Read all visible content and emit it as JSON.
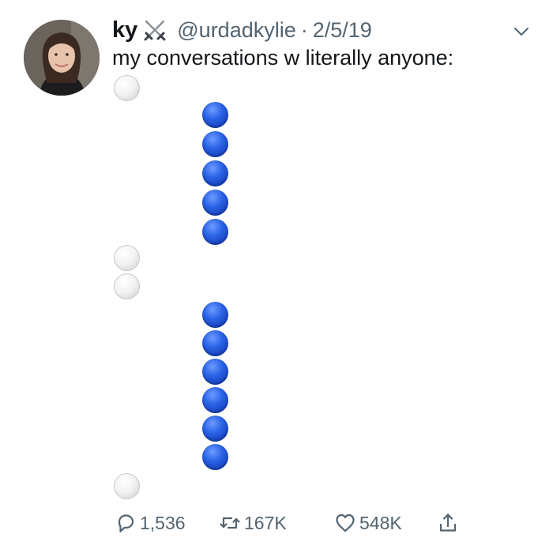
{
  "user": {
    "display_name": "ky",
    "name_emoji": "crossed-swords-icon",
    "handle": "@urdadkylie",
    "separator": "·",
    "date": "2/5/19"
  },
  "tweet": {
    "text": "my conversations w literally anyone:",
    "emoji_sequence": [
      "white",
      "blue",
      "blue",
      "blue",
      "blue",
      "blue",
      "white",
      "white",
      "blue",
      "blue",
      "blue",
      "blue",
      "blue",
      "blue",
      "white"
    ]
  },
  "actions": {
    "reply": {
      "icon": "reply-icon",
      "count": "1,536"
    },
    "retweet": {
      "icon": "retweet-icon",
      "count": "167K"
    },
    "like": {
      "icon": "heart-icon",
      "count": "548K"
    },
    "share": {
      "icon": "share-icon"
    }
  },
  "colors": {
    "text": "#14171a",
    "secondary": "#536471",
    "blue_circle": "#1f56d8",
    "white_circle": "#e6e6e6"
  }
}
